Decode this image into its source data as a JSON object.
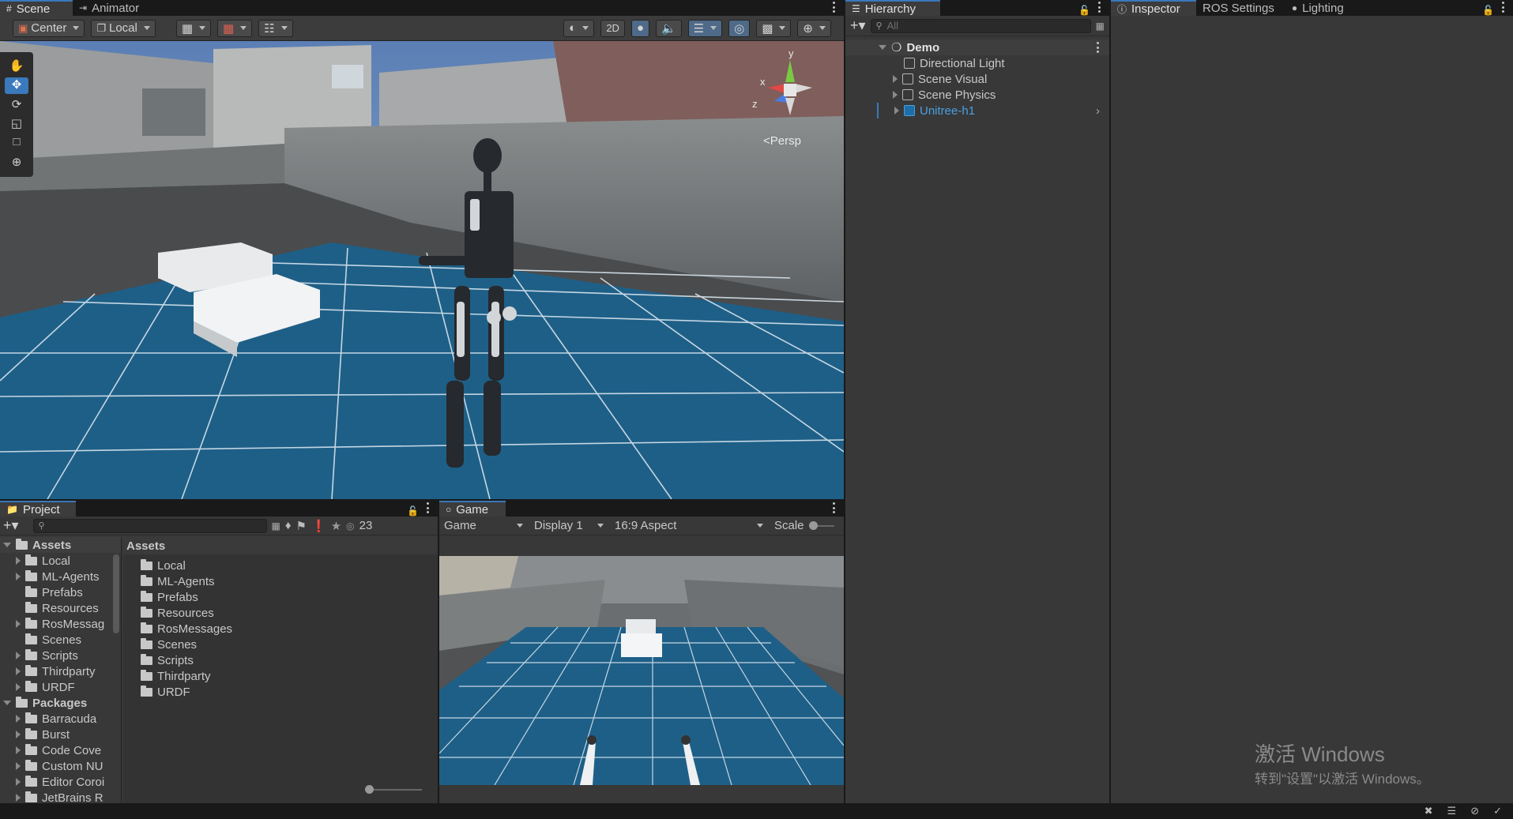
{
  "scene_panel": {
    "tabs": [
      "Scene",
      "Animator"
    ],
    "toolbar": {
      "pivot": "Center",
      "space": "Local",
      "mode_2d": "2D"
    },
    "gizmo": {
      "axis_y": "y",
      "axis_x": "x",
      "axis_z": "z",
      "projection": "Persp"
    }
  },
  "hierarchy": {
    "tab": "Hierarchy",
    "search_placeholder": "All",
    "root": "Demo",
    "items": [
      "Directional Light",
      "Scene Visual",
      "Scene Physics",
      "Unitree-h1"
    ],
    "selected_color": "#4aa0e0"
  },
  "inspector_tabs": [
    "Inspector",
    "ROS Settings",
    "Lighting"
  ],
  "project": {
    "tab": "Project",
    "count": "23",
    "tree": {
      "assets_label": "Assets",
      "assets": [
        "Local",
        "ML-Agents",
        "Prefabs",
        "Resources",
        "RosMessag",
        "Scenes",
        "Scripts",
        "Thirdparty",
        "URDF"
      ],
      "packages_label": "Packages",
      "packages": [
        "Barracuda",
        "Burst",
        "Code Cove",
        "Custom NU",
        "Editor Coroi",
        "JetBrains R"
      ]
    },
    "content": {
      "header": "Assets",
      "items": [
        "Local",
        "ML-Agents",
        "Prefabs",
        "Resources",
        "RosMessages",
        "Scenes",
        "Scripts",
        "Thirdparty",
        "URDF"
      ]
    }
  },
  "game": {
    "tab": "Game",
    "view": "Game",
    "display": "Display 1",
    "aspect": "16:9 Aspect",
    "scale_label": "Scale"
  },
  "watermark": {
    "line1": "激活 Windows",
    "line2": "转到\"设置\"以激活 Windows。"
  },
  "colors": {
    "accent": "#3a79bb",
    "floor": "#1e5f87",
    "panel": "#383838"
  }
}
